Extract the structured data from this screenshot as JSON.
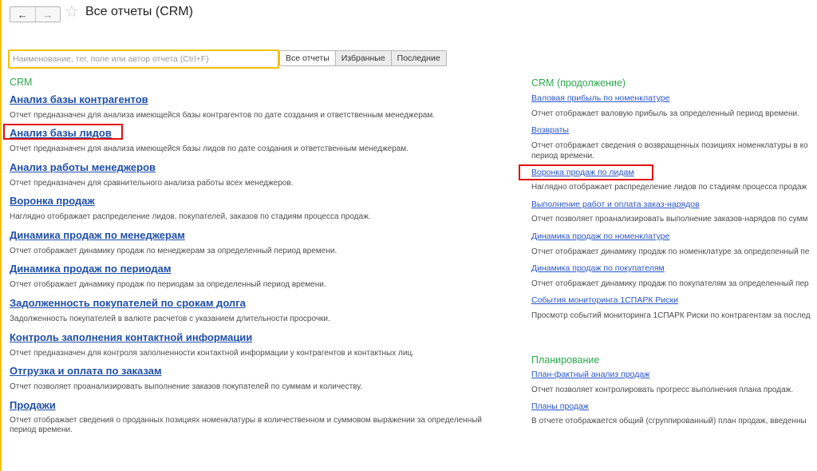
{
  "header": {
    "back_icon": "←",
    "forward_icon": "→",
    "star_icon": "☆",
    "title": "Все отчеты (CRM)"
  },
  "search": {
    "placeholder": "Наименование, тег, поле или автор отчета (Ctrl+F)",
    "value": ""
  },
  "tabs": [
    "Все отчеты",
    "Избранные",
    "Последние"
  ],
  "active_tab": "Все отчеты",
  "colors": {
    "section": "#2ea84f",
    "link": "#1f4fa8",
    "highlight": "#e01010",
    "accent": "#f2c200"
  },
  "left": {
    "title": "CRM",
    "items": [
      {
        "label": "Анализ базы контрагентов",
        "desc": "Отчет предназначен для анализа имеющейся базы контрагентов по дате создания и ответственным менеджерам."
      },
      {
        "label": "Анализ базы лидов",
        "desc": "Отчет предназначен для анализа имеющейся базы лидов по дате создания и ответственным менеджерам.",
        "highlighted": true
      },
      {
        "label": "Анализ работы менеджеров",
        "desc": "Отчет предназначен для сравнительного анализа работы всех менеджеров."
      },
      {
        "label": "Воронка продаж",
        "desc": "Наглядно отображает распределение лидов, покупателей, заказов по стадиям процесса продаж."
      },
      {
        "label": "Динамика продаж по менеджерам",
        "desc": "Отчет отображает динамику продаж по менеджерам за определенный период времени."
      },
      {
        "label": "Динамика продаж по периодам",
        "desc": "Отчет отображает динамику продаж по периодам за определенный период времени."
      },
      {
        "label": "Задолженность покупателей по срокам долга",
        "desc": "Задолженность покупателей в валюте расчетов с указанием длительности просрочки."
      },
      {
        "label": "Контроль заполнения контактной информации",
        "desc": "Отчет предназначен для контроля заполненности контактной информации у контрагентов и контактных лиц."
      },
      {
        "label": "Отгрузка и оплата по заказам",
        "desc": "Отчет позволяет проанализировать выполнение заказов покупателей по суммам и количеству."
      },
      {
        "label": "Продажи",
        "desc": "Отчет отображает сведения о проданных позициях номенклатуры в количественном и суммовом выражении за определенный период времени."
      }
    ]
  },
  "right": {
    "title": "CRM (продолжение)",
    "items": [
      {
        "label": "Валовая прибыль по номенклатуре",
        "desc": "Отчет отображает валовую прибыль за определенный период времени."
      },
      {
        "label": "Возвраты",
        "desc": "Отчет отображает сведения о возвращенных позициях номенклатуры в ко",
        "desc2": "период времени."
      },
      {
        "label": "Воронка продаж по лидам",
        "desc": "Наглядно отображает распределение лидов по стадиям процесса продаж",
        "highlighted": true
      },
      {
        "label": "Выполнение работ и оплата заказ-нарядов",
        "desc": "Отчет позволяет проанализировать выполнение заказов-нарядов по сумм"
      },
      {
        "label": "Динамика продаж по номенклатуре",
        "desc": "Отчет отображает динамику продаж по номенклатуре за определенный пе"
      },
      {
        "label": "Динамика продаж по покупателям",
        "desc": "Отчет отображает динамику продаж по покупателям за определенный пер"
      },
      {
        "label": "События мониторинга 1СПАРК Риски",
        "desc": "Просмотр событий мониторинга 1СПАРК Риски по контрагентам за послед"
      }
    ],
    "planning": {
      "title": "Планирование",
      "items": [
        {
          "label": "План-фактный анализ продаж",
          "desc": "Отчет позволяет контролировать прогресс выполнения плана продаж."
        },
        {
          "label": "Планы продаж",
          "desc": "В отчете отображается общий (сгруппированный) план продаж, введенны"
        }
      ]
    }
  }
}
